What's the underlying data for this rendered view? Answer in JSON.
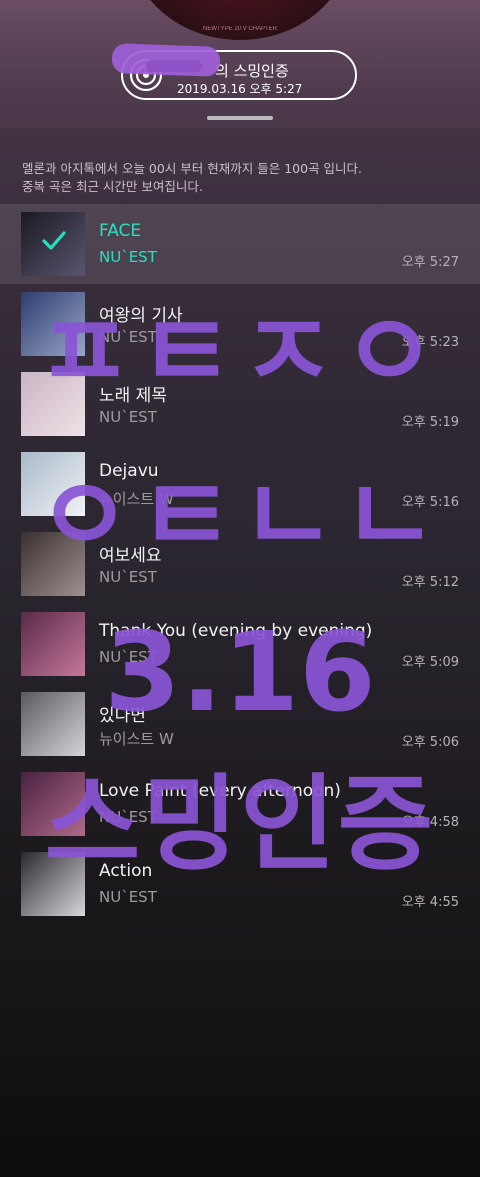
{
  "header": {
    "album_art_text": "NEWTYPE 20 V CHAPTER",
    "certification_title": "의 스밍인증",
    "timestamp": "2019.03.16 오후 5:27"
  },
  "notice": {
    "line1": "멜론과 아지톡에서 오늘 00시 부터 현재까지 들은 100곡 입니다.",
    "line2": "중복 곡은 최근 시간만 보여집니다."
  },
  "songs": [
    {
      "title": "FACE",
      "artist": "NU`EST",
      "time": "오후 5:27",
      "active": true,
      "art": [
        "#1a1a22",
        "#5a5570"
      ]
    },
    {
      "title": "여왕의 기사",
      "artist": "NU`EST",
      "time": "오후 5:23",
      "art": [
        "#2c3d6e",
        "#9aa6c8"
      ]
    },
    {
      "title": "노래 제목",
      "artist": "NU`EST",
      "time": "오후 5:19",
      "art": [
        "#c9b5c4",
        "#efe2e7"
      ]
    },
    {
      "title": "Dejavu",
      "artist": "뉴이스트 W",
      "time": "오후 5:16",
      "art": [
        "#a9b9c9",
        "#f1f3f6"
      ]
    },
    {
      "title": "여보세요",
      "artist": "NU`EST",
      "time": "오후 5:12",
      "art": [
        "#3a3030",
        "#a09090"
      ]
    },
    {
      "title": "Thank You (evening by evening)",
      "artist": "NU`EST",
      "time": "오후 5:09",
      "art": [
        "#5a2a48",
        "#c4789a"
      ]
    },
    {
      "title": "있다면",
      "artist": "뉴이스트 W",
      "time": "오후 5:06",
      "art": [
        "#5a5a60",
        "#d4d4d8"
      ]
    },
    {
      "title": "Love Paint (every afternoon)",
      "artist": "NU`EST",
      "time": "오후 4:58",
      "art": [
        "#4a2240",
        "#b06a8a"
      ]
    },
    {
      "title": "Action",
      "artist": "NU`EST",
      "time": "오후 4:55",
      "art": [
        "#2a2a2e",
        "#d8d8dc"
      ]
    }
  ],
  "watermark": {
    "line1": "ㅍㅌㅈㅇ",
    "line2": "ㅇㅌㄴㄴ",
    "line3": "3.16",
    "line4": "스밍인증",
    "color": "#8a55d6"
  }
}
